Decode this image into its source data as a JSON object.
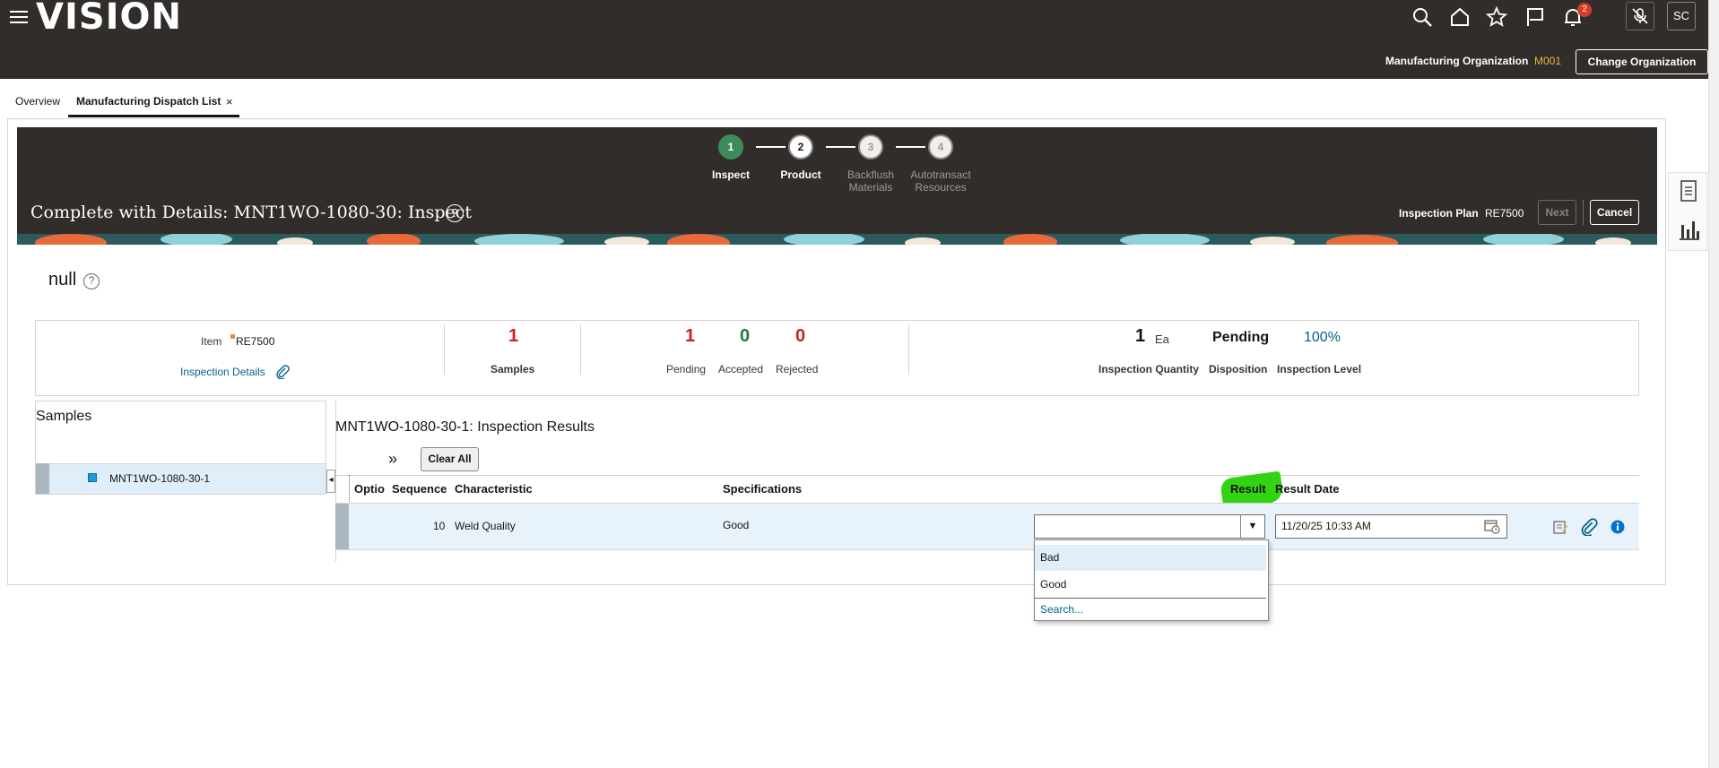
{
  "header": {
    "logo": "VISION",
    "notification_count": "2",
    "avatar_initials": "SC",
    "org_label": "Manufacturing Organization",
    "org_value": "M001",
    "change_org_label": "Change Organization"
  },
  "tabs": [
    {
      "label": "Overview"
    },
    {
      "label": "Manufacturing Dispatch List",
      "close": "×"
    }
  ],
  "train": {
    "steps": [
      {
        "number": "1",
        "label": "Inspect",
        "state": "current"
      },
      {
        "number": "2",
        "label": "Product",
        "state": "enabled"
      },
      {
        "number": "3",
        "label": "Backflush Materials",
        "state": "disabled"
      },
      {
        "number": "4",
        "label": "Autotransact Resources",
        "state": "disabled"
      }
    ],
    "step3_line1": "Backflush",
    "step3_line2": "Materials",
    "step4_line1": "Autotransact",
    "step4_line2": "Resources"
  },
  "page": {
    "title": "Complete with Details: MNT1WO-1080-30: Inspect",
    "inspection_plan_label": "Inspection Plan",
    "inspection_plan_value": "RE7500",
    "next_label": "Next",
    "cancel_label": "Cancel"
  },
  "section": {
    "title": "null"
  },
  "summary": {
    "item_label": "Item",
    "item_value": "RE7500",
    "inspection_details_link": "Inspection Details",
    "samples_count": "1",
    "samples_label": "Samples",
    "pending_count": "1",
    "pending_label": "Pending",
    "accepted_count": "0",
    "accepted_label": "Accepted",
    "rejected_count": "0",
    "rejected_label": "Rejected",
    "inspection_quantity": "1",
    "inspection_quantity_uom": "Ea",
    "inspection_quantity_label": "Inspection Quantity",
    "disposition_value": "Pending",
    "disposition_label": "Disposition",
    "inspection_level_value": "100%",
    "inspection_level_label": "Inspection Level"
  },
  "samples": {
    "title": "Samples",
    "items": [
      {
        "name": "MNT1WO-1080-30-1"
      }
    ]
  },
  "results": {
    "title": "MNT1WO-1080-30-1: Inspection Results",
    "clear_all_label": "Clear All",
    "columns": [
      "Optio",
      "Sequence",
      "Characteristic",
      "Specifications",
      "Result",
      "Result Date"
    ],
    "rows": [
      {
        "sequence": "10",
        "characteristic": "Weld Quality",
        "specifications": "Good",
        "result": "",
        "result_date": "11/20/25 10:33 AM"
      }
    ],
    "dropdown_options": [
      "Bad",
      "Good"
    ],
    "dropdown_search": "Search..."
  },
  "colors": {
    "header_bg": "#312d2a",
    "step_current": "#3e8a5a",
    "pending_red": "#c9211e",
    "accepted_green": "#277a3e",
    "link_blue": "#04618a",
    "highlight_green": "#32d412"
  }
}
